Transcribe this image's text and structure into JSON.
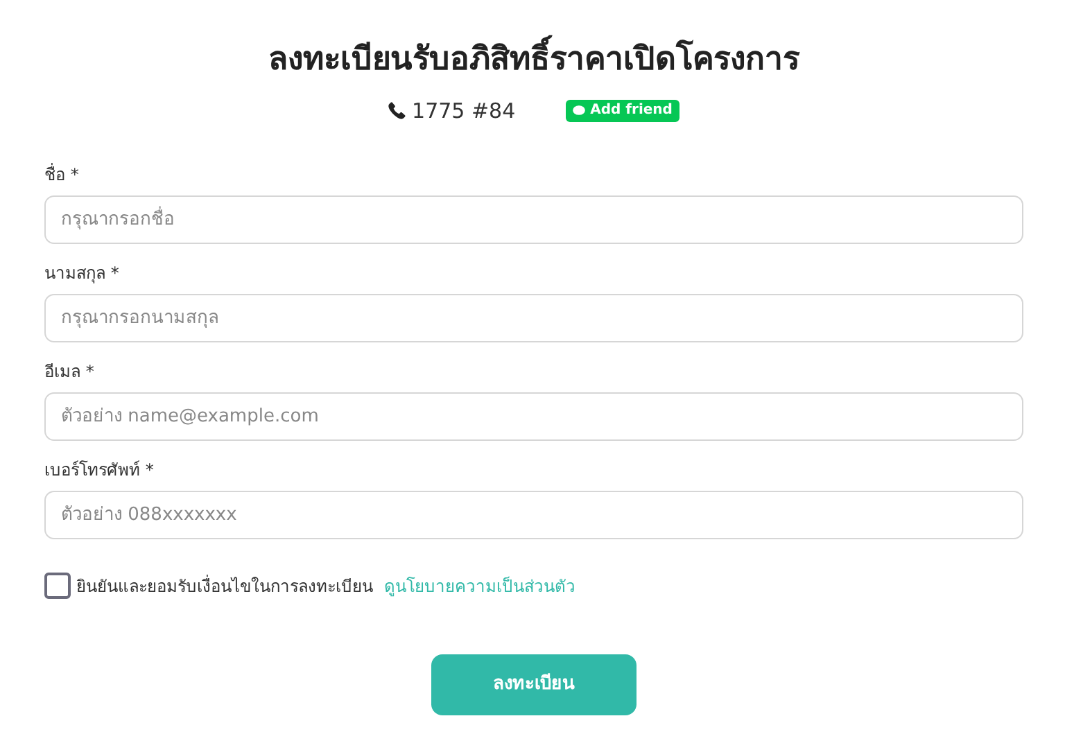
{
  "title": "ลงทะเบียนรับอภิสิทธิ์ราคาเปิดโครงการ",
  "contact": {
    "phone": "1775 #84",
    "line_button": "Add friend"
  },
  "fields": [
    {
      "label": "ชื่อ *",
      "placeholder": "กรุณากรอกชื่อ"
    },
    {
      "label": "นามสกุล *",
      "placeholder": "กรุณากรอกนามสกุล"
    },
    {
      "label": "อีเมล *",
      "placeholder": "ตัวอย่าง name@example.com"
    },
    {
      "label": "เบอร์โทรศัพท์ *",
      "placeholder": "ตัวอย่าง 088xxxxxxx"
    }
  ],
  "consent": {
    "checked": false,
    "text": "ยินยันและยอมรับเงื่อนไขในการลงทะเบียน",
    "link": "ดูนโยบายความเป็นส่วนตัว"
  },
  "submit": "ลงทะเบียน"
}
